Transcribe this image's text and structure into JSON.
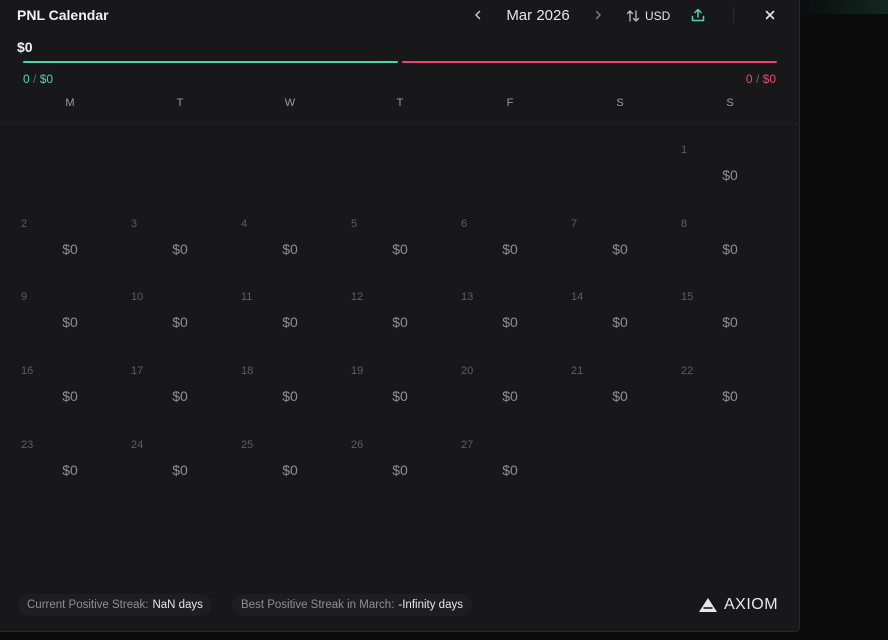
{
  "header": {
    "title": "PNL Calendar",
    "month": "Mar 2026",
    "currency": "USD"
  },
  "summary": {
    "total": "$0",
    "positive_count": "0",
    "positive_amount": "$0",
    "negative_count": "0",
    "negative_amount": "$0",
    "slash": "/"
  },
  "weekdays": [
    "M",
    "T",
    "W",
    "T",
    "F",
    "S",
    "S"
  ],
  "calendar": {
    "leading_blank_days": 6,
    "days": [
      {
        "day": "1",
        "pnl": "$0"
      },
      {
        "day": "2",
        "pnl": "$0"
      },
      {
        "day": "3",
        "pnl": "$0"
      },
      {
        "day": "4",
        "pnl": "$0"
      },
      {
        "day": "5",
        "pnl": "$0"
      },
      {
        "day": "6",
        "pnl": "$0"
      },
      {
        "day": "7",
        "pnl": "$0"
      },
      {
        "day": "8",
        "pnl": "$0"
      },
      {
        "day": "9",
        "pnl": "$0"
      },
      {
        "day": "10",
        "pnl": "$0"
      },
      {
        "day": "11",
        "pnl": "$0"
      },
      {
        "day": "12",
        "pnl": "$0"
      },
      {
        "day": "13",
        "pnl": "$0"
      },
      {
        "day": "14",
        "pnl": "$0"
      },
      {
        "day": "15",
        "pnl": "$0"
      },
      {
        "day": "16",
        "pnl": "$0"
      },
      {
        "day": "17",
        "pnl": "$0"
      },
      {
        "day": "18",
        "pnl": "$0"
      },
      {
        "day": "19",
        "pnl": "$0"
      },
      {
        "day": "20",
        "pnl": "$0"
      },
      {
        "day": "21",
        "pnl": "$0"
      },
      {
        "day": "22",
        "pnl": "$0"
      },
      {
        "day": "23",
        "pnl": "$0"
      },
      {
        "day": "24",
        "pnl": "$0"
      },
      {
        "day": "25",
        "pnl": "$0"
      },
      {
        "day": "26",
        "pnl": "$0"
      },
      {
        "day": "27",
        "pnl": "$0"
      }
    ]
  },
  "footer": {
    "current_streak_label": "Current Positive Streak:",
    "current_streak_value": "NaN days",
    "best_streak_label": "Best Positive Streak in March:",
    "best_streak_value": "-Infinity days",
    "brand": "AXIOM"
  },
  "icons": {
    "prev": "chevron-left-icon",
    "next": "chevron-right-icon",
    "currency_toggle": "swap-vertical-icon",
    "share": "share-upload-icon",
    "close": "close-icon",
    "brand_logo": "axiom-logo-icon"
  },
  "colors": {
    "positive": "#4fd4a8",
    "negative": "#e8466e",
    "panel": "#18181b"
  }
}
